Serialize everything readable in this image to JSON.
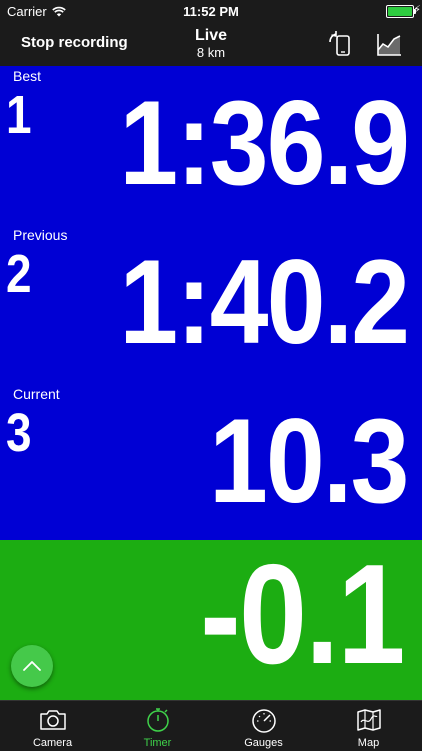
{
  "status_bar": {
    "carrier": "Carrier",
    "time": "11:52 PM"
  },
  "nav": {
    "stop_label": "Stop recording",
    "title": "Live",
    "subtitle": "8 km"
  },
  "timer": {
    "rows": [
      {
        "label": "Best",
        "index": "1",
        "value": "1:36.9"
      },
      {
        "label": "Previous",
        "index": "2",
        "value": "1:40.2"
      },
      {
        "label": "Current",
        "index": "3",
        "value": "10.3"
      }
    ],
    "delta": "-0.1"
  },
  "tabs": [
    {
      "label": "Camera",
      "icon": "camera-icon",
      "active": false
    },
    {
      "label": "Timer",
      "icon": "stopwatch-icon",
      "active": true
    },
    {
      "label": "Gauges",
      "icon": "gauge-icon",
      "active": false
    },
    {
      "label": "Map",
      "icon": "map-icon",
      "active": false
    }
  ],
  "colors": {
    "timer_bg": "#0000d4",
    "delta_bg": "#1cad12",
    "accent": "#3fd24a",
    "bar_bg": "#1b1b1b"
  }
}
